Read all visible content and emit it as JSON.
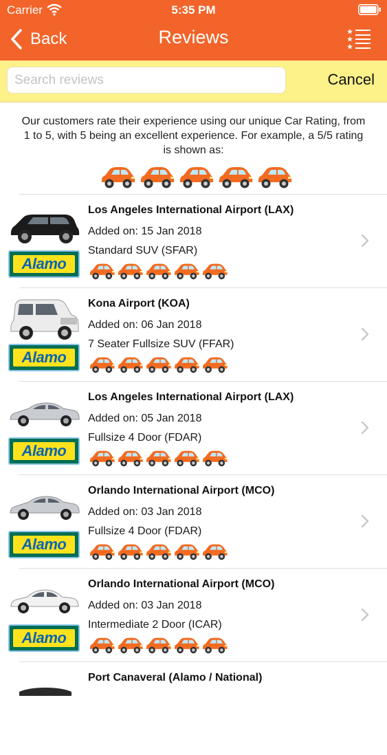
{
  "status_bar": {
    "carrier": "Carrier",
    "time": "5:35 PM"
  },
  "nav": {
    "back_label": "Back",
    "title": "Reviews"
  },
  "search": {
    "placeholder": "Search reviews",
    "value": "",
    "cancel_label": "Cancel"
  },
  "intro": {
    "text": "Our customers rate their experience using our unique Car Rating, from 1 to 5, with 5 being an excellent experience. For example, a 5/5 rating is shown as:",
    "example_rating": 5
  },
  "colors": {
    "nav": "#f2642a",
    "search_bar": "#fdf18a",
    "rating_car": "#f26b21",
    "alamo_green": "#006e52",
    "alamo_yellow": "#fde21d",
    "alamo_blue": "#0b65b0"
  },
  "reviews": [
    {
      "location": "Los Angeles International Airport (LAX)",
      "added": "Added on: 15 Jan 2018",
      "car_class": "Standard SUV (SFAR)",
      "rating": 5,
      "vehicle": "black-suv",
      "brand": "Alamo"
    },
    {
      "location": "Kona Airport (KOA)",
      "added": "Added on: 06 Jan 2018",
      "car_class": "7 Seater Fullsize SUV (FFAR)",
      "rating": 5,
      "vehicle": "white-full-size-suv",
      "brand": "Alamo"
    },
    {
      "location": "Los Angeles International Airport (LAX)",
      "added": "Added on: 05 Jan 2018",
      "car_class": "Fullsize 4 Door (FDAR)",
      "rating": 5,
      "vehicle": "silver-sedan",
      "brand": "Alamo"
    },
    {
      "location": "Orlando International Airport (MCO)",
      "added": "Added on: 03 Jan 2018",
      "car_class": "Fullsize 4 Door (FDAR)",
      "rating": 5,
      "vehicle": "silver-sedan",
      "brand": "Alamo"
    },
    {
      "location": "Orlando International Airport (MCO)",
      "added": "Added on: 03 Jan 2018",
      "car_class": "Intermediate 2 Door (ICAR)",
      "rating": 5,
      "vehicle": "white-compact-car",
      "brand": "Alamo"
    },
    {
      "location": "Port Canaveral (Alamo / National)",
      "added": "",
      "car_class": "",
      "rating": 0,
      "vehicle": "dark-car",
      "brand": ""
    }
  ]
}
